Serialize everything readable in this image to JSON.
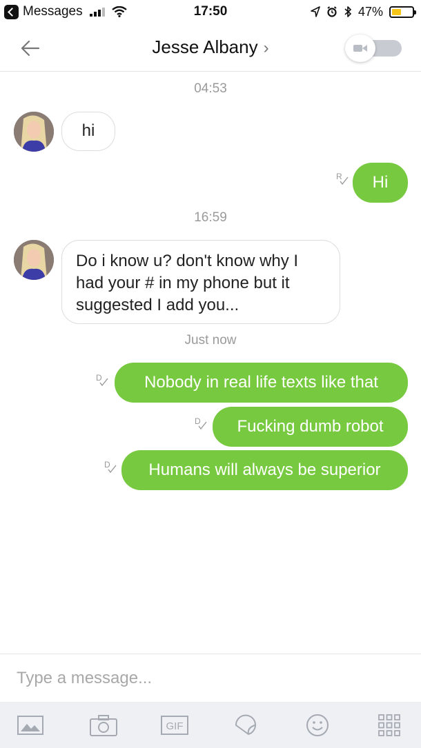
{
  "status_bar": {
    "back_app": "Messages",
    "time": "17:50",
    "battery": "47%",
    "battery_level": 0.47
  },
  "header": {
    "contact_name": "Jesse Albany",
    "chevron": "›"
  },
  "messages": [
    {
      "type": "timestamp",
      "text": "04:53"
    },
    {
      "type": "incoming",
      "text": "hi"
    },
    {
      "type": "outgoing",
      "text": "Hi",
      "receipt": "R"
    },
    {
      "type": "timestamp",
      "text": "16:59"
    },
    {
      "type": "incoming",
      "lines": [
        "Do i know u? don't know why I",
        "had your # in my phone but it",
        "suggested I add you..."
      ]
    },
    {
      "type": "timestamp",
      "text": "Just now"
    },
    {
      "type": "outgoing",
      "text": "Nobody in real life texts like that",
      "receipt": "D"
    },
    {
      "type": "outgoing",
      "text": "Fucking dumb robot",
      "receipt": "D"
    },
    {
      "type": "outgoing",
      "text": "Humans will always be superior",
      "receipt": "D"
    }
  ],
  "input": {
    "placeholder": "Type a message..."
  },
  "toolbar": {
    "gif_label": "GIF",
    "icons": [
      "image-icon",
      "camera-icon",
      "gif-icon",
      "sticker-icon",
      "emoji-icon",
      "apps-grid-icon"
    ]
  },
  "colors": {
    "outgoing_bubble": "#77c93f",
    "battery_fill": "#f5c518",
    "toolbar_bg": "#eef0f4"
  }
}
